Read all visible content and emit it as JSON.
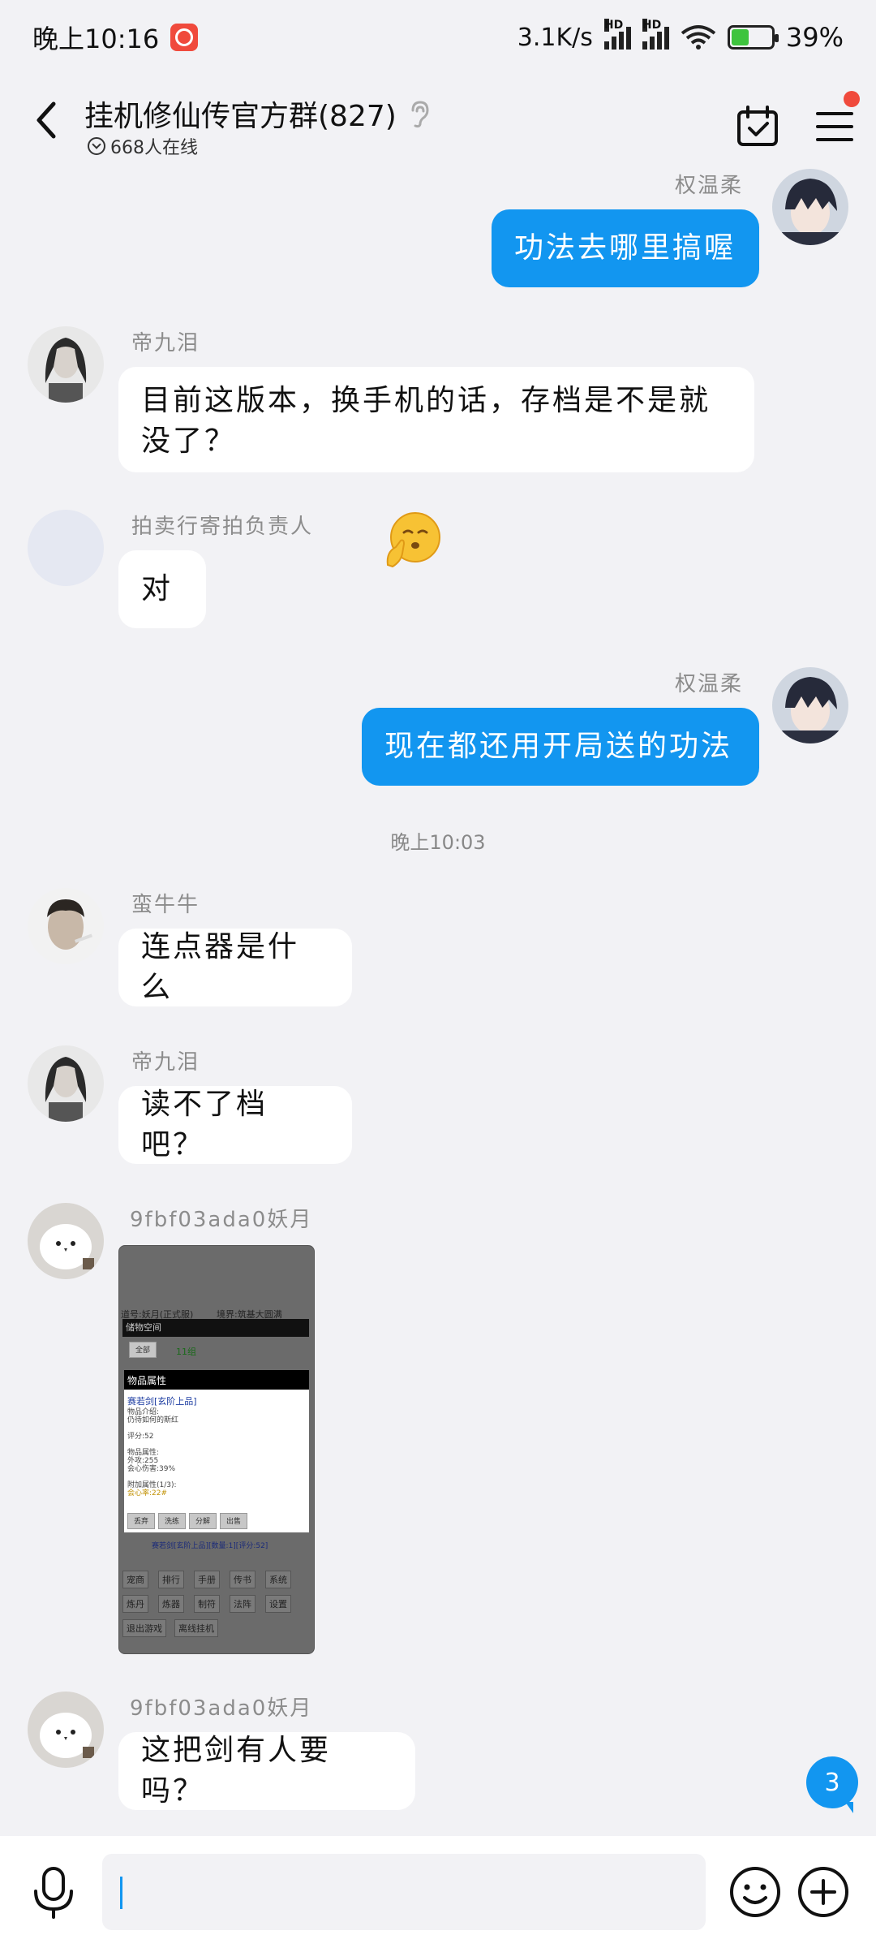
{
  "status_bar": {
    "time": "晚上10:16",
    "network_speed": "3.1K/s",
    "signal1_label": "HD",
    "signal2_label": "HD",
    "battery": "39%"
  },
  "header": {
    "title": "挂机修仙传官方群(827)",
    "online": "668人在线"
  },
  "timestamp": "晚上10:03",
  "messages": [
    {
      "sender": "权温柔",
      "text": "功法去哪里搞喔"
    },
    {
      "sender": "帝九泪",
      "text": "目前这版本，换手机的话，存档是不是就\n没了？"
    },
    {
      "sender": "拍卖行寄拍负责人",
      "text": "对"
    },
    {
      "sender": "权温柔",
      "text": "现在都还用开局送的功法"
    },
    {
      "sender": "蛮牛牛",
      "text": "连点器是什么"
    },
    {
      "sender": "帝九泪",
      "text": "读不了档吧？"
    },
    {
      "sender": "9fbf03ada0妖月"
    },
    {
      "sender": "9fbf03ada0妖月",
      "text": "这把剑有人要吗？"
    }
  ],
  "screenshot": {
    "top_text": "道号:妖月(正式服)",
    "realm_text": "境界:筑基大圆满",
    "storage_header": "储物空间",
    "tab_all": "全部",
    "tab_value": "11组",
    "panel_header": "物品属性",
    "item_name": "赛若剑[玄阶上品]",
    "lines": [
      "物品介绍:",
      "仍待如何的斯红",
      "",
      "评分:52",
      "",
      "物品属性:",
      "外攻:255",
      "会心伤害:39%",
      "",
      "附加属性(1/3):",
      "会心率:22#"
    ],
    "panel_buttons": [
      "丢弃",
      "洗练",
      "分解",
      "出售"
    ],
    "bottom_item": "赛若剑[玄阶上品][数量:1][评分:52]",
    "menu_row1": [
      "宠商",
      "排行",
      "手册",
      "传书",
      "系统"
    ],
    "menu_row2": [
      "炼丹",
      "炼器",
      "制符",
      "法阵",
      "设置"
    ],
    "menu_row3": [
      "退出游戏",
      "离线挂机"
    ]
  },
  "unread_count": "3",
  "input": {
    "placeholder": ""
  },
  "colors": {
    "background": "#f2f2f5",
    "bubble_out": "#1296f0",
    "bubble_in": "#ffffff",
    "badge": "#f04a3c"
  },
  "icons": [
    "back-arrow-icon",
    "ear-icon",
    "calendar-check-icon",
    "hamburger-menu-icon",
    "microphone-icon",
    "smiley-icon",
    "plus-circle-icon",
    "shush-emoji"
  ]
}
